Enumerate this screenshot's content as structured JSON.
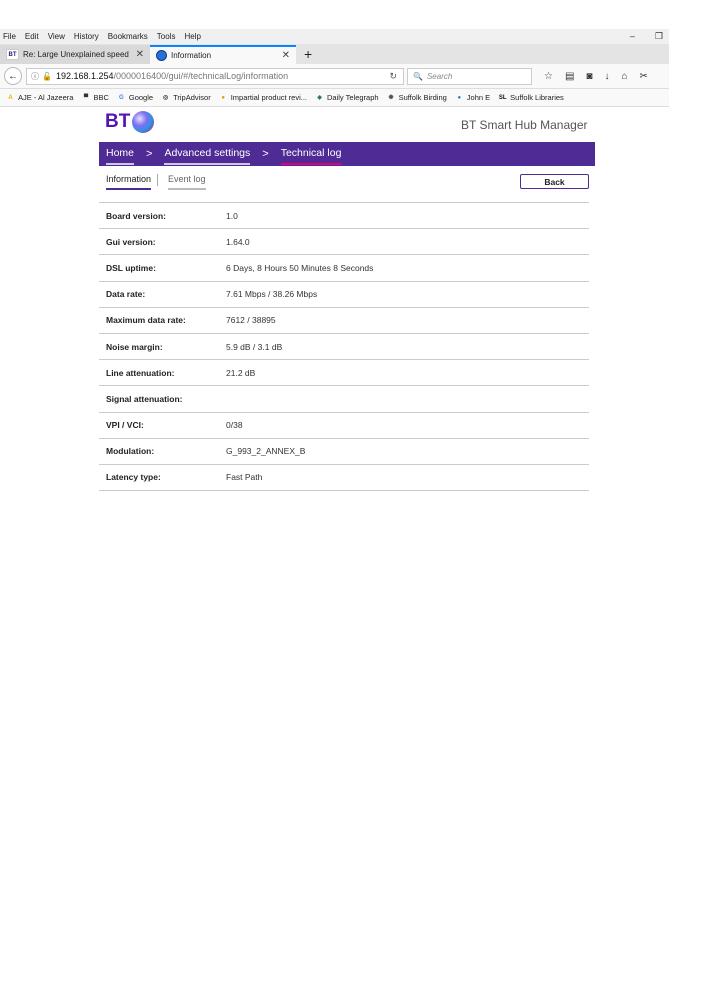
{
  "menubar": {
    "items": [
      "File",
      "Edit",
      "View",
      "History",
      "Bookmarks",
      "Tools",
      "Help"
    ],
    "minimize": "–",
    "restore": "❐"
  },
  "tabs": [
    {
      "favicon": "BT",
      "title": "Re: Large Unexplained speed",
      "close": "✕"
    },
    {
      "title": "Information",
      "close": "✕"
    }
  ],
  "newtab": "+",
  "navbar": {
    "back": "←",
    "url_host": "192.168.1.254",
    "url_path": "/0000016400/gui/#/technicalLog/information",
    "search_placeholder": "Search",
    "icons": [
      "☆",
      "▤",
      "◙",
      "↓",
      "⌂",
      "✂"
    ]
  },
  "bookmarks": [
    {
      "icon": "A",
      "label": "AJE - Al Jazeera",
      "color": "#f2a900"
    },
    {
      "icon": "▀",
      "label": "BBC",
      "color": "#333333"
    },
    {
      "icon": "G",
      "label": "Google",
      "color": "#4285f4"
    },
    {
      "icon": "◎",
      "label": "TripAdvisor",
      "color": "#333333"
    },
    {
      "icon": "●",
      "label": "Impartial product revi...",
      "color": "#f29000"
    },
    {
      "icon": "◈",
      "label": "Daily Telegraph",
      "color": "#1b6e3b"
    },
    {
      "icon": "✺",
      "label": "Suffolk Birding",
      "color": "#555555"
    },
    {
      "icon": "●",
      "label": "John E",
      "color": "#2a6fd6"
    },
    {
      "icon": "SL",
      "label": "Suffolk Libraries",
      "color": "#111111"
    }
  ],
  "page": {
    "logo_text": "BT",
    "hub_title": "BT Smart Hub Manager",
    "breadcrumb": [
      "Home",
      "Advanced settings",
      "Technical log"
    ],
    "breadcrumb_separator": ">",
    "subtabs": [
      "Information",
      "Event log"
    ],
    "back_button": "Back",
    "rows": [
      {
        "label": "Board version:",
        "value": "1.0"
      },
      {
        "label": "Gui version:",
        "value": "1.64.0"
      },
      {
        "label": "DSL uptime:",
        "value": "6 Days, 8 Hours 50 Minutes 8 Seconds"
      },
      {
        "label": "Data rate:",
        "value": "7.61 Mbps / 38.26 Mbps"
      },
      {
        "label": "Maximum data rate:",
        "value": "7612 / 38895"
      },
      {
        "label": "Noise margin:",
        "value": "5.9 dB / 3.1 dB"
      },
      {
        "label": "Line attenuation:",
        "value": "21.2 dB"
      },
      {
        "label": "Signal attenuation:",
        "value": ""
      },
      {
        "label": "VPI / VCI:",
        "value": "0/38"
      },
      {
        "label": "Modulation:",
        "value": "G_993_2_ANNEX_B"
      },
      {
        "label": "Latency type:",
        "value": "Fast Path"
      }
    ]
  },
  "colors": {
    "bt_purple": "#4e2b95",
    "bt_logo_purple": "#5514b4",
    "active_underline": "#e0007a"
  }
}
